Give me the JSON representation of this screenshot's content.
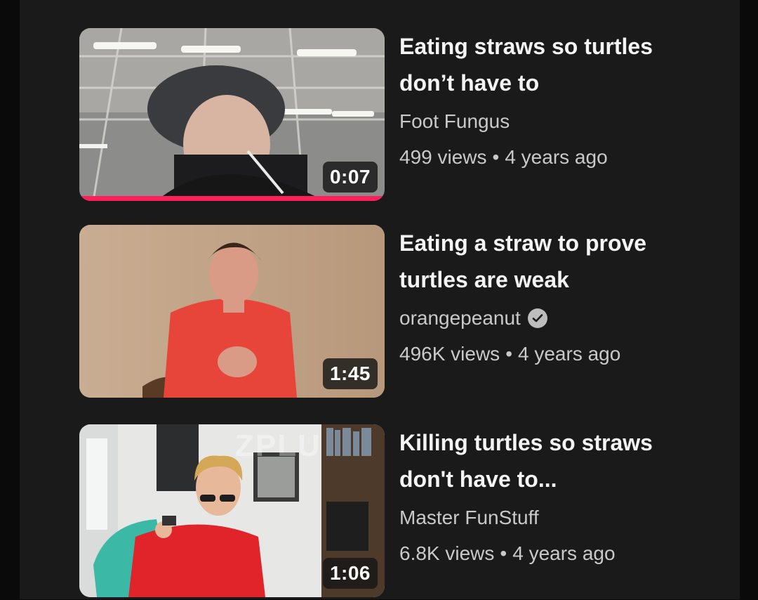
{
  "videos": [
    {
      "title_line1": "Eating straws so turtles",
      "title_line2": "don’t have to",
      "channel": "Foot Fungus",
      "views": "499 views",
      "age": "4 years ago",
      "duration": "0:07",
      "watch_progress": 1.0
    },
    {
      "title_line1": "Eating a straw to prove",
      "title_line2": "turtles are weak",
      "channel": "orangepeanut",
      "views": "496K views",
      "age": "4 years ago",
      "duration": "1:45",
      "verified_icon": "check-circle-icon"
    },
    {
      "title_line1": "Killing turtles so straws",
      "title_line2": "don't have to...",
      "channel": "Master FunStuff",
      "views": "6.8K views",
      "age": "4 years ago",
      "duration": "1:06",
      "watermark": "ZPLU"
    }
  ],
  "separator": "•",
  "colors": {
    "background": "#1b1a1b",
    "progress_bar": "#ff1f5a",
    "title_text": "#f4f4f4",
    "meta_text": "#c9c9c9"
  }
}
